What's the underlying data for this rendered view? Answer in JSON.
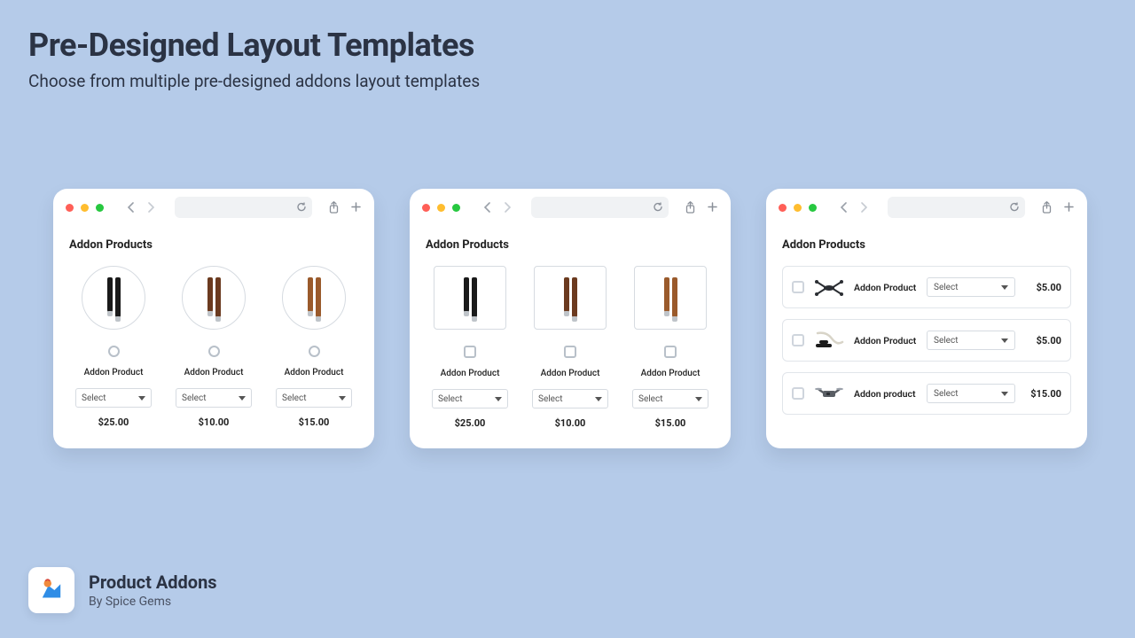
{
  "page": {
    "title": "Pre-Designed Layout Templates",
    "subtitle": "Choose from multiple pre-designed addons layout templates"
  },
  "section_title": "Addon Products",
  "select_label": "Select",
  "template1": {
    "items": [
      {
        "name": "Addon Product",
        "price": "$25.00",
        "strap_color": "#1a1a1a"
      },
      {
        "name": "Addon Product",
        "price": "$10.00",
        "strap_color": "#6b3a1f"
      },
      {
        "name": "Addon Product",
        "price": "$15.00",
        "strap_color": "#9a5a2b"
      }
    ]
  },
  "template2": {
    "items": [
      {
        "name": "Addon Product",
        "price": "$25.00",
        "strap_color": "#1a1a1a"
      },
      {
        "name": "Addon Product",
        "price": "$10.00",
        "strap_color": "#6b3a1f"
      },
      {
        "name": "Addon Product",
        "price": "$15.00",
        "strap_color": "#9a5a2b"
      }
    ]
  },
  "template3": {
    "items": [
      {
        "name": "Addon Product",
        "price": "$5.00"
      },
      {
        "name": "Addon Product",
        "price": "$5.00"
      },
      {
        "name": "Addon product",
        "price": "$15.00"
      }
    ]
  },
  "footer": {
    "app_name": "Product Addons",
    "byline": "By Spice Gems"
  }
}
